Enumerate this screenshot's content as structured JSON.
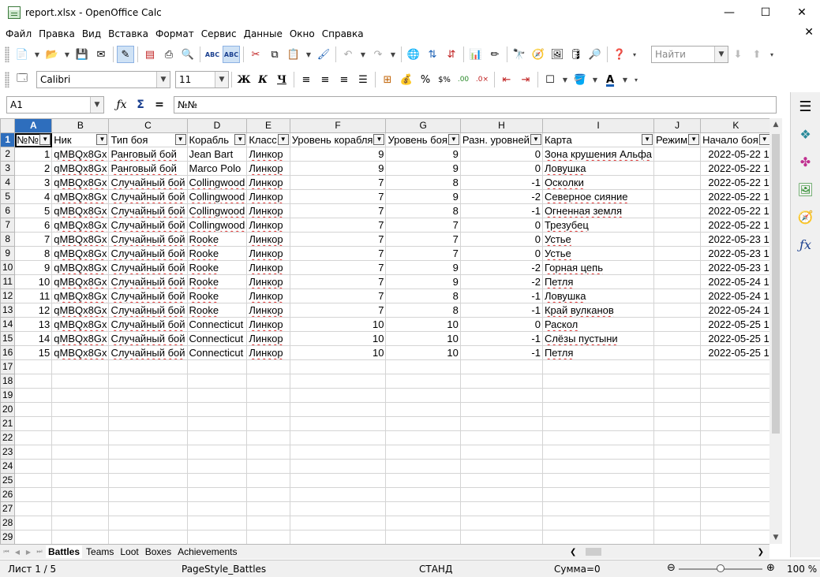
{
  "window": {
    "title": "report.xlsx - OpenOffice Calc",
    "minimize": "—",
    "maximize": "☐",
    "close": "✕"
  },
  "menu": [
    "Файл",
    "Правка",
    "Вид",
    "Вставка",
    "Формат",
    "Сервис",
    "Данные",
    "Окно",
    "Справка"
  ],
  "menu_close": "✕",
  "toolbar": {
    "find_placeholder": "Найти",
    "font_name": "Calibri",
    "font_size": "11",
    "bold": "Ж",
    "italic": "К",
    "underline": "Ч"
  },
  "formula_bar": {
    "cell_ref": "A1",
    "content": "№№",
    "fx": "ƒx",
    "sigma": "Σ",
    "equals": "="
  },
  "columns": [
    {
      "letter": "A"
    },
    {
      "letter": "B"
    },
    {
      "letter": "C"
    },
    {
      "letter": "D"
    },
    {
      "letter": "E"
    },
    {
      "letter": "F"
    },
    {
      "letter": "G"
    },
    {
      "letter": "H"
    },
    {
      "letter": "I"
    },
    {
      "letter": "J"
    },
    {
      "letter": "K"
    }
  ],
  "headers": [
    "№№",
    "Ник",
    "Тип боя",
    "Корабль",
    "Класс",
    "Уровень корабля",
    "Уровень боя",
    "Разн. уровней",
    "Карта",
    "Режим",
    "Начало боя"
  ],
  "rows": [
    [
      "1",
      "qMBQx8Gx",
      "Ранговый бой",
      "Jean Bart",
      "Линкор",
      "9",
      "9",
      "0",
      "Зона крушения Альфа",
      "",
      "2022-05-22 1"
    ],
    [
      "2",
      "qMBQx8Gx",
      "Ранговый бой",
      "Marco Polo",
      "Линкор",
      "9",
      "9",
      "0",
      "Ловушка",
      "",
      "2022-05-22 1"
    ],
    [
      "3",
      "qMBQx8Gx",
      "Случайный бой",
      "Collingwood",
      "Линкор",
      "7",
      "8",
      "-1",
      "Осколки",
      "",
      "2022-05-22 1"
    ],
    [
      "4",
      "qMBQx8Gx",
      "Случайный бой",
      "Collingwood",
      "Линкор",
      "7",
      "9",
      "-2",
      "Северное сияние",
      "",
      "2022-05-22 1"
    ],
    [
      "5",
      "qMBQx8Gx",
      "Случайный бой",
      "Collingwood",
      "Линкор",
      "7",
      "8",
      "-1",
      "Огненная земля",
      "",
      "2022-05-22 1"
    ],
    [
      "6",
      "qMBQx8Gx",
      "Случайный бой",
      "Collingwood",
      "Линкор",
      "7",
      "7",
      "0",
      "Трезубец",
      "",
      "2022-05-22 1"
    ],
    [
      "7",
      "qMBQx8Gx",
      "Случайный бой",
      "Rooke",
      "Линкор",
      "7",
      "7",
      "0",
      "Устье",
      "",
      "2022-05-23 1"
    ],
    [
      "8",
      "qMBQx8Gx",
      "Случайный бой",
      "Rooke",
      "Линкор",
      "7",
      "7",
      "0",
      "Устье",
      "",
      "2022-05-23 1"
    ],
    [
      "9",
      "qMBQx8Gx",
      "Случайный бой",
      "Rooke",
      "Линкор",
      "7",
      "9",
      "-2",
      "Горная цепь",
      "",
      "2022-05-23 1"
    ],
    [
      "10",
      "qMBQx8Gx",
      "Случайный бой",
      "Rooke",
      "Линкор",
      "7",
      "9",
      "-2",
      "Петля",
      "",
      "2022-05-24 1"
    ],
    [
      "11",
      "qMBQx8Gx",
      "Случайный бой",
      "Rooke",
      "Линкор",
      "7",
      "8",
      "-1",
      "Ловушка",
      "",
      "2022-05-24 1"
    ],
    [
      "12",
      "qMBQx8Gx",
      "Случайный бой",
      "Rooke",
      "Линкор",
      "7",
      "8",
      "-1",
      "Край вулканов",
      "",
      "2022-05-24 1"
    ],
    [
      "13",
      "qMBQx8Gx",
      "Случайный бой",
      "Connecticut",
      "Линкор",
      "10",
      "10",
      "0",
      "Раскол",
      "",
      "2022-05-25 1"
    ],
    [
      "14",
      "qMBQx8Gx",
      "Случайный бой",
      "Connecticut",
      "Линкор",
      "10",
      "10",
      "-1",
      "Слёзы пустыни",
      "",
      "2022-05-25 1"
    ],
    [
      "15",
      "qMBQx8Gx",
      "Случайный бой",
      "Connecticut",
      "Линкор",
      "10",
      "10",
      "-1",
      "Петля",
      "",
      "2022-05-25 1"
    ]
  ],
  "empty_rows": [
    "17",
    "18",
    "19",
    "20",
    "21",
    "22",
    "23",
    "24",
    "25",
    "26",
    "27",
    "28",
    "29"
  ],
  "sheets": [
    "Battles",
    "Teams",
    "Loot",
    "Boxes",
    "Achievements"
  ],
  "status": {
    "sheet": "Лист 1 / 5",
    "page_style": "PageStyle_Battles",
    "mode": "СТАНД",
    "sum": "Сумма=0",
    "zoom": "100 %"
  },
  "colors": {
    "selected_header": "#2e6ebd",
    "spellcheck": "#e03030"
  }
}
